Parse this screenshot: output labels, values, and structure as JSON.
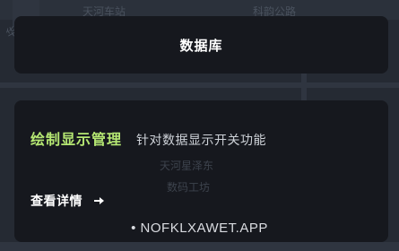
{
  "map": {
    "labels": [
      "天河车站",
      "科韵公路",
      "天河星泽东",
      "数码工坊",
      "华河"
    ]
  },
  "database_card": {
    "title": "数据库"
  },
  "feature_card": {
    "title": "绘制显示管理",
    "description": "针对数据显示开关功能",
    "details_label": "查看详情",
    "arrow_icon": "arrow-right-icon"
  },
  "watermark": {
    "text": "• NOFKLXAWET.APP"
  },
  "colors": {
    "accent": "#b6e873",
    "card_bg": "#16181e",
    "map_bg": "#252a33"
  }
}
